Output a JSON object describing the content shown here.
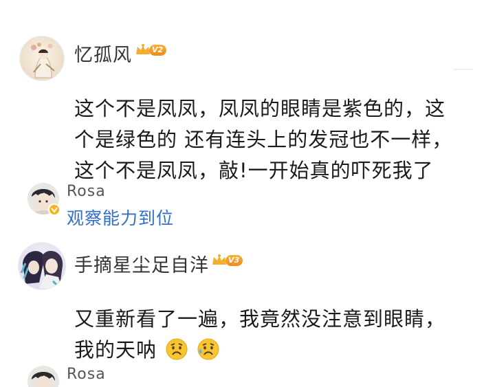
{
  "comments": [
    {
      "username": "忆孤风",
      "level": "V2",
      "lines": [
        "这个不是凤凤，凤凤的眼睛是紫色的，这",
        "个是绿色的 还有连头上的发冠也不一样，",
        "这个不是凤凤，敲!一开始真的吓死我了"
      ],
      "reply": {
        "username": "Rosa",
        "text": "观察能力到位"
      }
    },
    {
      "username": "手摘星尘足自洋",
      "level": "V3",
      "lines": [
        "又重新看了一遍，我竟然没注意到眼睛，",
        "我的天呐"
      ],
      "emojis": [
        "worried-face-icon",
        "worried-sweat-face-icon"
      ],
      "reply": {
        "username": "Rosa"
      }
    }
  ],
  "colors": {
    "reply_link": "#2f6fc9",
    "badge_orange": "#f08a1c",
    "verified_gold": "#f5b31b"
  }
}
